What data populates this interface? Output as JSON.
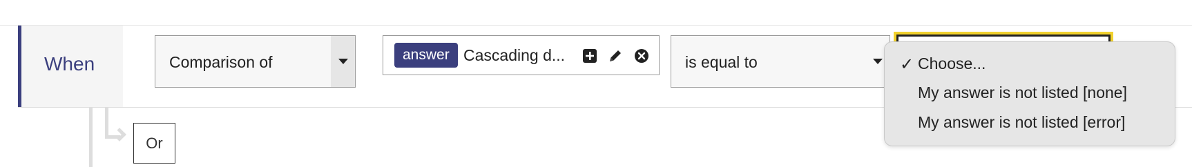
{
  "rule": {
    "when_label": "When",
    "comparison_select": {
      "value": "Comparison of"
    },
    "answer_field": {
      "badge": "answer",
      "text": "Cascading d...",
      "icons": [
        "plus-square-icon",
        "pencil-icon",
        "close-circle-icon"
      ]
    },
    "operator_select": {
      "value": "is equal to"
    },
    "value_dropdown": {
      "options": [
        {
          "label": "Choose...",
          "selected": true
        },
        {
          "label": "My answer is not listed [none]",
          "selected": false
        },
        {
          "label": "My answer is not listed [error]",
          "selected": false
        }
      ],
      "checkmark": "✓"
    }
  },
  "or_button": {
    "label": "Or"
  },
  "colors": {
    "accent": "#3b3f7e",
    "highlight": "#f2d22e",
    "dropdown_bg": "#e6e6e6",
    "connector": "#dddddd"
  }
}
